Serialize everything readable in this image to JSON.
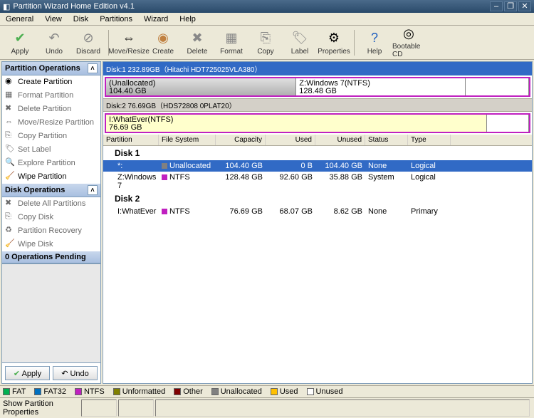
{
  "window": {
    "title": "Partition Wizard Home Edition v4.1"
  },
  "menu": {
    "items": [
      "General",
      "View",
      "Disk",
      "Partitions",
      "Wizard",
      "Help"
    ]
  },
  "toolbar": {
    "apply": "Apply",
    "undo": "Undo",
    "discard": "Discard",
    "moveresize": "Move/Resize",
    "create": "Create",
    "delete": "Delete",
    "format": "Format",
    "copy": "Copy",
    "label": "Label",
    "properties": "Properties",
    "help": "Help",
    "bootable": "Bootable CD"
  },
  "sidebar": {
    "partition_ops_title": "Partition Operations",
    "partition_ops": [
      "Create Partition",
      "Format Partition",
      "Delete Partition",
      "Move/Resize Partition",
      "Copy Partition",
      "Set Label",
      "Explore Partition",
      "Wipe Partition"
    ],
    "disk_ops_title": "Disk Operations",
    "disk_ops": [
      "Delete All Partitions",
      "Copy Disk",
      "Partition Recovery",
      "Wipe Disk"
    ],
    "pending_title": "0 Operations Pending",
    "apply_btn": "Apply",
    "undo_btn": "Undo"
  },
  "disks": {
    "d1_header": "Disk:1 232.89GB（Hitachi HDT725025VLA380）",
    "d1_seg1_name": "(Unallocated)",
    "d1_seg1_size": "104.40 GB",
    "d1_seg2_name": "Z:Windows 7(NTFS)",
    "d1_seg2_size": "128.48 GB",
    "d2_header": "Disk:2 76.69GB（HDS72808 0PLAT20）",
    "d2_seg1_name": "I:WhatEver(NTFS)",
    "d2_seg1_size": "76.69 GB"
  },
  "grid": {
    "h_part": "Partition",
    "h_fs": "File System",
    "h_cap": "Capacity",
    "h_used": "Used",
    "h_unused": "Unused",
    "h_stat": "Status",
    "h_type": "Type",
    "disk1_title": "Disk 1",
    "r1_part": "*:",
    "r1_fs": "Unallocated",
    "r1_cap": "104.40 GB",
    "r1_used": "0 B",
    "r1_unused": "104.40 GB",
    "r1_stat": "None",
    "r1_type": "Logical",
    "r2_part": "Z:Windows 7",
    "r2_fs": "NTFS",
    "r2_cap": "128.48 GB",
    "r2_used": "92.60 GB",
    "r2_unused": "35.88 GB",
    "r2_stat": "System",
    "r2_type": "Logical",
    "disk2_title": "Disk 2",
    "r3_part": "I:WhatEver",
    "r3_fs": "NTFS",
    "r3_cap": "76.69 GB",
    "r3_used": "68.07 GB",
    "r3_unused": "8.62 GB",
    "r3_stat": "None",
    "r3_type": "Primary"
  },
  "legend": {
    "fat": "FAT",
    "fat32": "FAT32",
    "ntfs": "NTFS",
    "unformatted": "Unformatted",
    "other": "Other",
    "unallocated": "Unallocated",
    "used": "Used",
    "unused": "Unused"
  },
  "statusbar": {
    "text": "Show Partition Properties"
  },
  "colors": {
    "fat": "#00b050",
    "fat32": "#0070c0",
    "ntfs": "#c020c0",
    "unformatted": "#808000",
    "other": "#800000",
    "unallocated": "#808080",
    "used": "#ffc000",
    "unused": "#ffffff"
  }
}
